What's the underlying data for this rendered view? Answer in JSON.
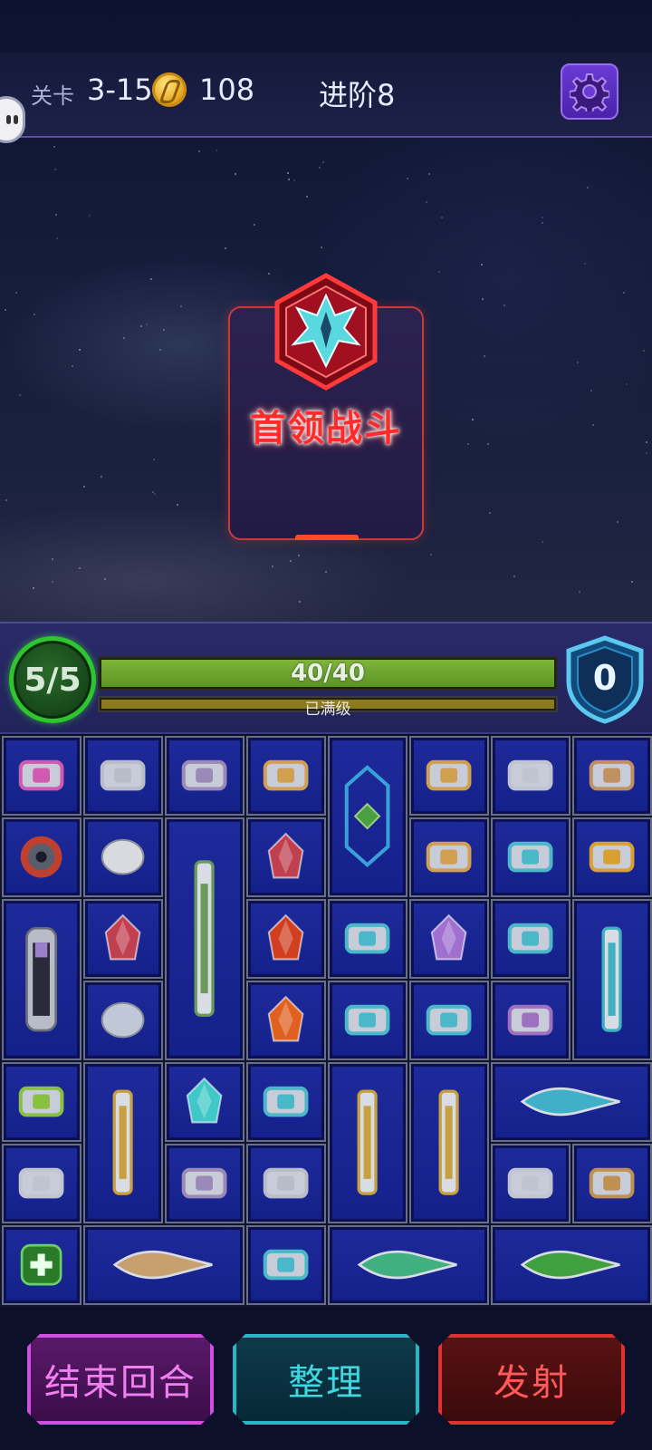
{
  "topbar": {
    "level_label": "关卡",
    "level_value": "3-15",
    "coins": "108",
    "rank": "进阶8",
    "settings_icon": "gear-icon"
  },
  "boss": {
    "title": "首领战斗",
    "emblem_icon": "boss-emblem-icon"
  },
  "status": {
    "energy": "5/5",
    "hp_text": "40/40",
    "hp_fraction": 1.0,
    "level_status": "已满级",
    "xp_fraction": 1.0,
    "shield": "0"
  },
  "grid": {
    "items": [
      {
        "name": "pink-module",
        "color": "#d05ab0"
      },
      {
        "name": "cannon-module",
        "color": "#b8bcc8"
      },
      {
        "name": "wing-module",
        "color": "#9a8ab8"
      },
      {
        "name": "thruster-module",
        "color": "#d0a050"
      },
      {
        "name": "hex-armor-module",
        "color": "#3aa0d8"
      },
      {
        "name": "thruster-module",
        "color": "#d0a050"
      },
      {
        "name": "bracket-module",
        "color": "#c0c4d0"
      },
      {
        "name": "engine-module",
        "color": "#c09060"
      },
      {
        "name": "gear-turret-module",
        "color": "#c04030"
      },
      {
        "name": "asteroid-module",
        "color": "#d8dae0"
      },
      {
        "name": "missile-module",
        "color": "#6a9a5a"
      },
      {
        "name": "crystal-red-module",
        "color": "#c04050"
      },
      {
        "name": "thruster-module",
        "color": "#d0a050"
      },
      {
        "name": "core-module",
        "color": "#4ab8c8"
      },
      {
        "name": "golden-ship-module",
        "color": "#d8a030"
      },
      {
        "name": "capsule-module",
        "color": "#9a80c8"
      },
      {
        "name": "crystal-red-module",
        "color": "#c04050"
      },
      {
        "name": "gem-module",
        "color": "#d04020"
      },
      {
        "name": "teal-armor-module",
        "color": "#4ab8c8"
      },
      {
        "name": "crystal-purple-module",
        "color": "#a070d0"
      },
      {
        "name": "core-module",
        "color": "#4ab8c8"
      },
      {
        "name": "fighter-module",
        "color": "#40b0c0"
      },
      {
        "name": "stone-module",
        "color": "#c0c8d8"
      },
      {
        "name": "amber-module",
        "color": "#e06020"
      },
      {
        "name": "teal-armor-module",
        "color": "#4ab8c8"
      },
      {
        "name": "teal-armor-module",
        "color": "#4ab8c8"
      },
      {
        "name": "core-module",
        "color": "#a070c0"
      },
      {
        "name": "green-armor-module",
        "color": "#8ac040"
      },
      {
        "name": "blade-module",
        "color": "#c8a040"
      },
      {
        "name": "ice-crystal-module",
        "color": "#40c8c8"
      },
      {
        "name": "teal-armor-module",
        "color": "#4ab8c8"
      },
      {
        "name": "blade-module",
        "color": "#c8a040"
      },
      {
        "name": "blade-module",
        "color": "#c8a040"
      },
      {
        "name": "jet-module",
        "color": "#40b0c8"
      },
      {
        "name": "bracket-module",
        "color": "#c0c4d0"
      },
      {
        "name": "wing-module",
        "color": "#9a8ab8"
      },
      {
        "name": "cannon-module",
        "color": "#b8bcc8"
      },
      {
        "name": "bracket-module",
        "color": "#c0c4d0"
      },
      {
        "name": "claw-module",
        "color": "#c09050"
      },
      {
        "name": "medkit-module",
        "color": "#3aa040"
      },
      {
        "name": "serpent-module",
        "color": "#c8a070"
      },
      {
        "name": "teal-armor-module",
        "color": "#4ab8c8"
      },
      {
        "name": "dagger-ship-module",
        "color": "#40b080"
      },
      {
        "name": "green-ship-module",
        "color": "#40a040"
      }
    ]
  },
  "actions": {
    "end_turn": "结束回合",
    "sort": "整理",
    "fire": "发射"
  }
}
